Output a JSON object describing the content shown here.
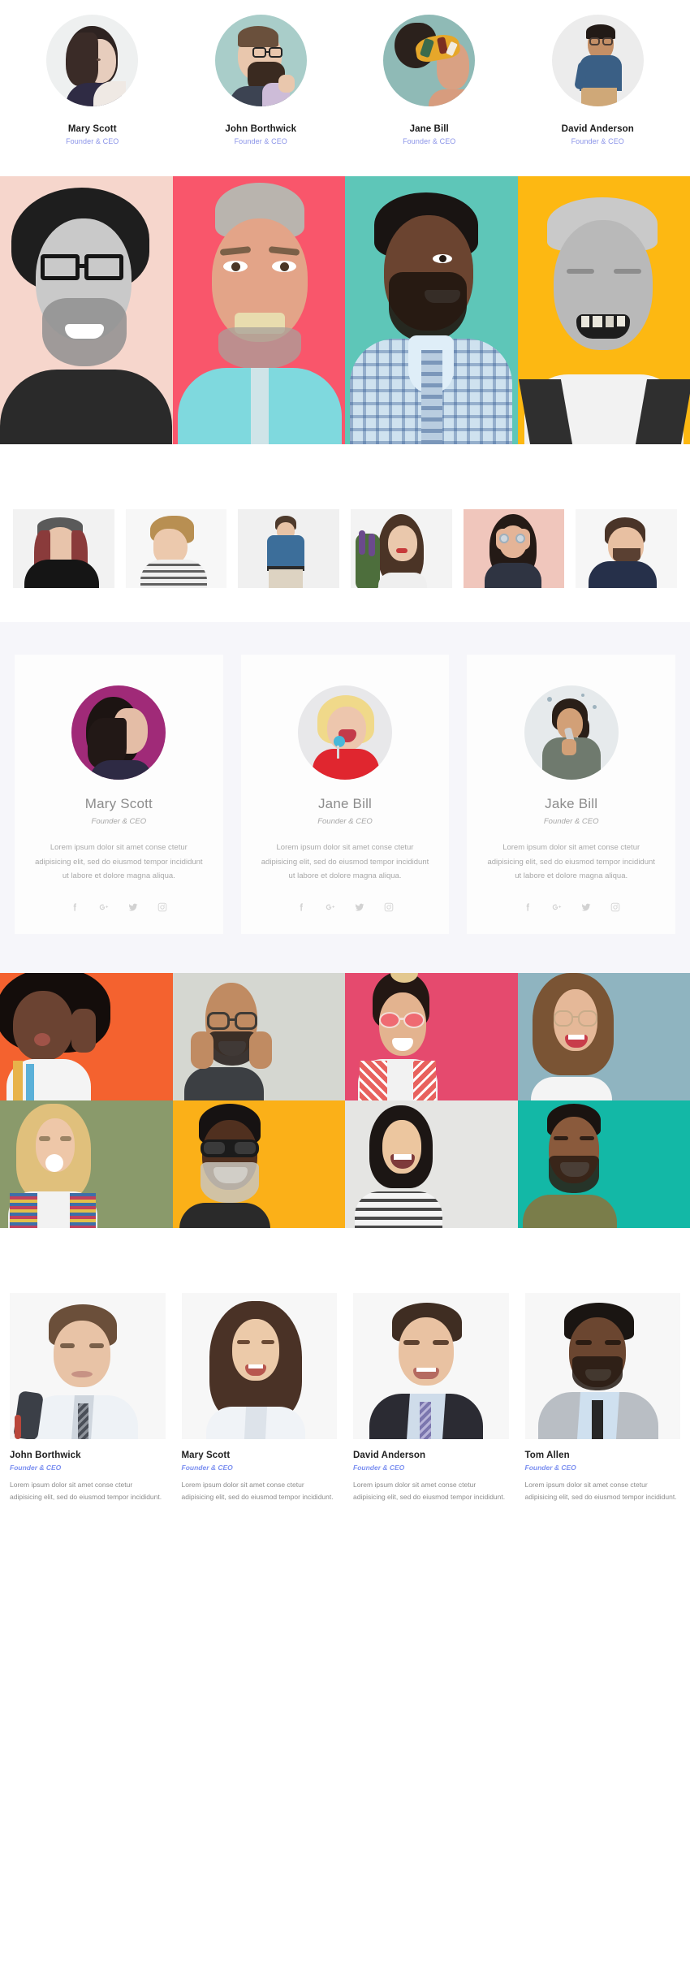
{
  "section_avatars": {
    "name": "team-avatars",
    "members": [
      {
        "name": "Mary Scott",
        "role": "Founder & CEO",
        "bg": "#eef0f0"
      },
      {
        "name": "John Borthwick",
        "role": "Founder & CEO",
        "bg": "#a9cdc9"
      },
      {
        "name": "Jane Bill",
        "role": "Founder & CEO",
        "bg": "#8fbab6"
      },
      {
        "name": "David Anderson",
        "role": "Founder & CEO",
        "bg": "#ececec"
      }
    ]
  },
  "section_panels": {
    "name": "colour-portrait-panels",
    "panels": [
      {
        "label": "man-glasses-curly-hair",
        "bg": "#f6d6cc",
        "skin": "#cfcfcf",
        "grayscale": true
      },
      {
        "label": "man-surprised-mohawk",
        "bg": "#f9566b",
        "skin": "#e8b89c",
        "grayscale": false
      },
      {
        "label": "man-checkered-shirt",
        "bg": "#5ec6b8",
        "skin": "#6b4430",
        "grayscale": false
      },
      {
        "label": "elderly-man-smiling",
        "bg": "#fdb812",
        "skin": "#d4d4d4",
        "grayscale": true
      }
    ]
  },
  "section_thumbs": {
    "name": "thumbnail-strip",
    "thumbs": [
      {
        "label": "woman-beanie-black-top",
        "bg": "#f2f2f2",
        "accent": "#1d1d1d"
      },
      {
        "label": "young-man-profile-stripes",
        "bg": "#f7f7f7",
        "accent": "#dcdcdc"
      },
      {
        "label": "man-blue-shirt-standing",
        "bg": "#f0f0f0",
        "accent": "#3a6d9c"
      },
      {
        "label": "woman-with-lavender",
        "bg": "#f3f3f3",
        "accent": "#6d4f8c"
      },
      {
        "label": "woman-hands-on-face",
        "bg": "#f0c6bc",
        "accent": "#2f2f3c"
      },
      {
        "label": "man-laughing-navy-shirt",
        "bg": "#f6f6f6",
        "accent": "#25304a"
      }
    ]
  },
  "section_cards": {
    "name": "team-cards",
    "cards": [
      {
        "name": "Mary Scott",
        "role": "Founder & CEO",
        "desc": "Lorem ipsum dolor sit amet conse ctetur adipisicing elit, sed do eiusmod tempor incididunt ut labore et dolore magna aliqua.",
        "circle_bg": "#a02a78",
        "socials": [
          "facebook",
          "google-plus",
          "twitter",
          "instagram"
        ]
      },
      {
        "name": "Jane Bill",
        "role": "Founder & CEO",
        "desc": "Lorem ipsum dolor sit amet conse ctetur adipisicing elit, sed do eiusmod tempor incididunt ut labore et dolore magna aliqua.",
        "circle_bg": "#e8e8ea",
        "socials": [
          "facebook",
          "google-plus",
          "twitter",
          "instagram"
        ]
      },
      {
        "name": "Jake Bill",
        "role": "Founder & CEO",
        "desc": "Lorem ipsum dolor sit amet conse ctetur adipisicing elit, sed do eiusmod tempor incididunt ut labore et dolore magna aliqua.",
        "circle_bg": "#e6eaec",
        "socials": [
          "facebook",
          "google-plus",
          "twitter",
          "instagram"
        ]
      }
    ]
  },
  "section_mosaic": {
    "name": "photo-mosaic",
    "tiles": [
      {
        "label": "woman-afro-orange",
        "bg": "#f4622f",
        "skin": "#6b4332",
        "hair": "#1b1310"
      },
      {
        "label": "man-glasses-grey",
        "bg": "#d5d7d1",
        "skin": "#c08b62",
        "hair": "#2b2320"
      },
      {
        "label": "woman-sunglasses-pink",
        "bg": "#e54a6e",
        "skin": "#e3b38f",
        "hair": "#231713"
      },
      {
        "label": "woman-glasses-blue",
        "bg": "#8fb4c0",
        "skin": "#e5b898",
        "hair": "#7a5434"
      },
      {
        "label": "woman-bubblegum-green",
        "bg": "#8a9a6b",
        "skin": "#eec7a8",
        "hair": "#e0c07c"
      },
      {
        "label": "man-sunglasses-yellow",
        "bg": "#fbb018",
        "skin": "#50301f",
        "hair": "#161212"
      },
      {
        "label": "woman-stripes-grey",
        "bg": "#e5e5e3",
        "skin": "#ecc69f",
        "hair": "#1c1614"
      },
      {
        "label": "man-beard-teal",
        "bg": "#13b8a6",
        "skin": "#8a5a3c",
        "hair": "#1a1310"
      }
    ]
  },
  "section_biz": {
    "name": "business-profile-cards",
    "cards": [
      {
        "name": "John Borthwick",
        "role": "Founder & CEO",
        "desc": "Lorem ipsum dolor sit amet conse ctetur adipisicing elit, sed do eiusmod tempor incididunt.",
        "photo": "man-suit-bag-over-shoulder"
      },
      {
        "name": "Mary Scott",
        "role": "Founder & CEO",
        "desc": "Lorem ipsum dolor sit amet conse ctetur adipisicing elit, sed do eiusmod tempor incididunt.",
        "photo": "woman-long-hair-white-blouse"
      },
      {
        "name": "David Anderson",
        "role": "Founder & CEO",
        "desc": "Lorem ipsum dolor sit amet conse ctetur adipisicing elit, sed do eiusmod tempor incididunt.",
        "photo": "man-dark-suit-purple-tie"
      },
      {
        "name": "Tom Allen",
        "role": "Founder & CEO",
        "desc": "Lorem ipsum dolor sit amet conse ctetur adipisicing elit, sed do eiusmod tempor incididunt.",
        "photo": "man-grey-suit-black-tie"
      }
    ]
  },
  "colors": {
    "role_accent": "#8a93e8",
    "biz_role_accent": "#7b8ff0",
    "card_section_bg": "#f6f6fa",
    "card_bg": "#fdfdfd",
    "social_icon": "#d2d2d2"
  }
}
